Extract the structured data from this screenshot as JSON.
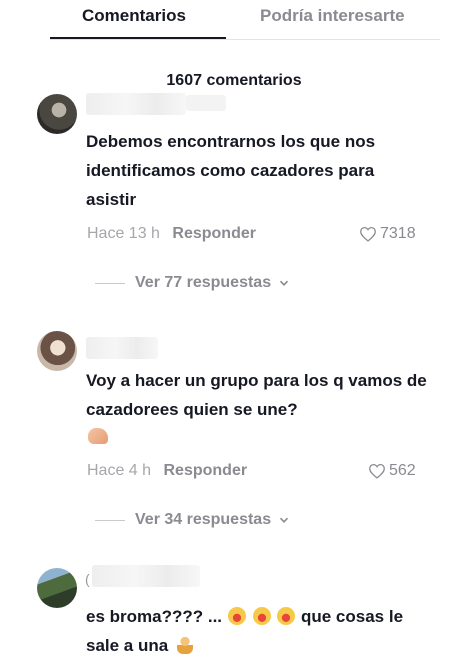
{
  "tabs": [
    {
      "label": "Comentarios",
      "active": true
    },
    {
      "label": "Podría interesarte",
      "active": false
    }
  ],
  "comment_count": "1607 comentarios",
  "comments": [
    {
      "text": "Debemos encontrarnos los que nos identificamos como cazadores para asistir",
      "time": "Hace 13 h",
      "reply_label": "Responder",
      "likes": "7318",
      "view_replies": "Ver 77 respuestas"
    },
    {
      "text": "Voy a hacer un grupo para los q vamos de cazadorees quien se une?",
      "time": "Hace 4 h",
      "reply_label": "Responder",
      "likes": "562",
      "view_replies": "Ver 34 respuestas"
    },
    {
      "text_part1": "es broma???? ...",
      "text_part2": "que cosas le sale a una",
      "name_initial": "("
    }
  ],
  "colors": {
    "primary_text": "#161823",
    "secondary_text": "#8a8b91",
    "muted_text": "#a6a7ab"
  }
}
